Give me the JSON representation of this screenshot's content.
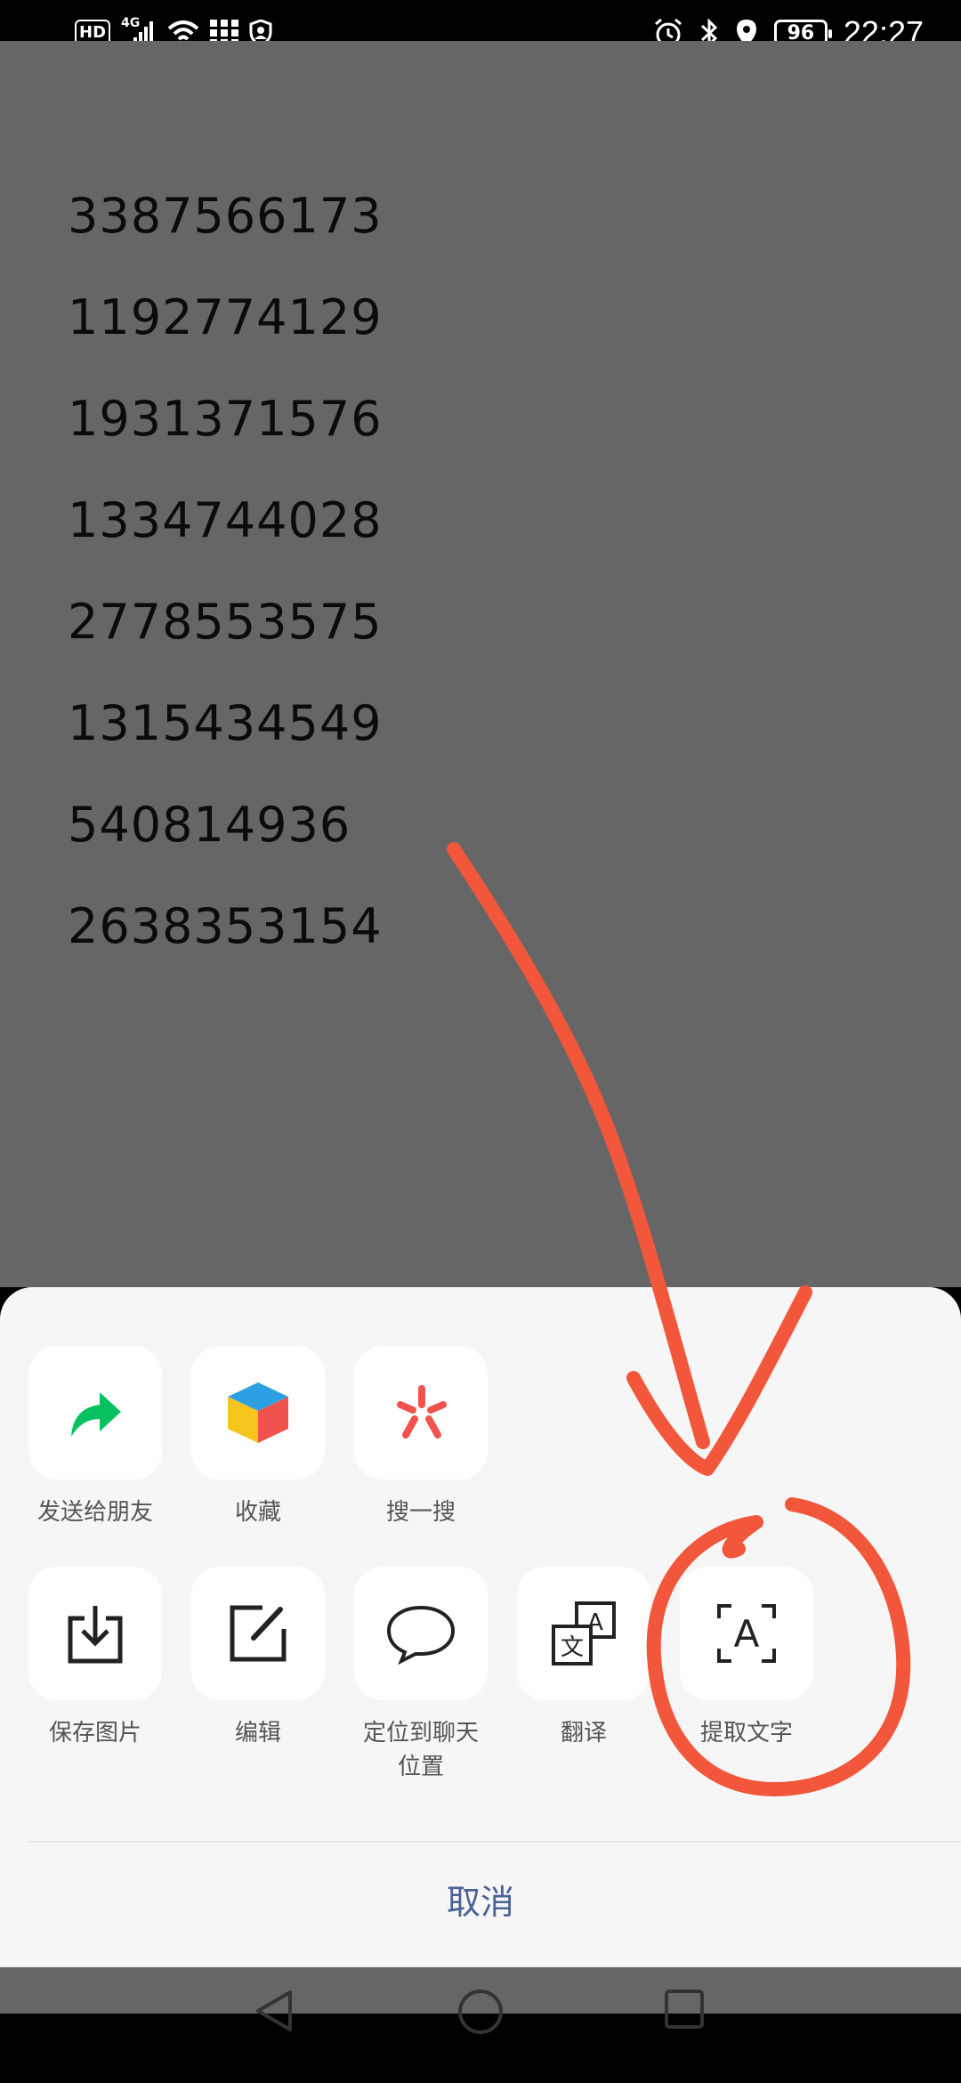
{
  "status_bar": {
    "hd_badge": "HD",
    "network": "4G",
    "battery": "96",
    "time": "22:27",
    "icons": [
      "hd-icon",
      "signal-icon",
      "wifi-icon",
      "app-grid-icon",
      "shield-icon",
      "alarm-icon",
      "bluetooth-icon",
      "location-icon",
      "battery-icon"
    ]
  },
  "content": {
    "numbers": [
      "3387566173",
      "1192774129",
      "1931371576",
      "1334744028",
      "2778553575",
      "1315434549",
      "540814936",
      "2638353154"
    ]
  },
  "sheet": {
    "row1": [
      {
        "label": "发送给朋友",
        "icon": "share-arrow-icon"
      },
      {
        "label": "收藏",
        "icon": "favorite-cube-icon"
      },
      {
        "label": "搜一搜",
        "icon": "search-star-icon"
      }
    ],
    "row2": [
      {
        "label": "保存图片",
        "icon": "download-icon"
      },
      {
        "label": "编辑",
        "icon": "edit-icon"
      },
      {
        "label": "定位到聊天位置",
        "label_line1": "定位到聊天",
        "label_line2": "位置",
        "icon": "chat-bubble-icon"
      },
      {
        "label": "翻译",
        "icon": "translate-icon"
      },
      {
        "label": "提取文字",
        "icon": "text-extract-icon"
      }
    ],
    "cancel": "取消"
  },
  "colors": {
    "accent_green": "#07c160",
    "cancel_blue": "#4b6294",
    "annotation_red": "#f2563b"
  }
}
